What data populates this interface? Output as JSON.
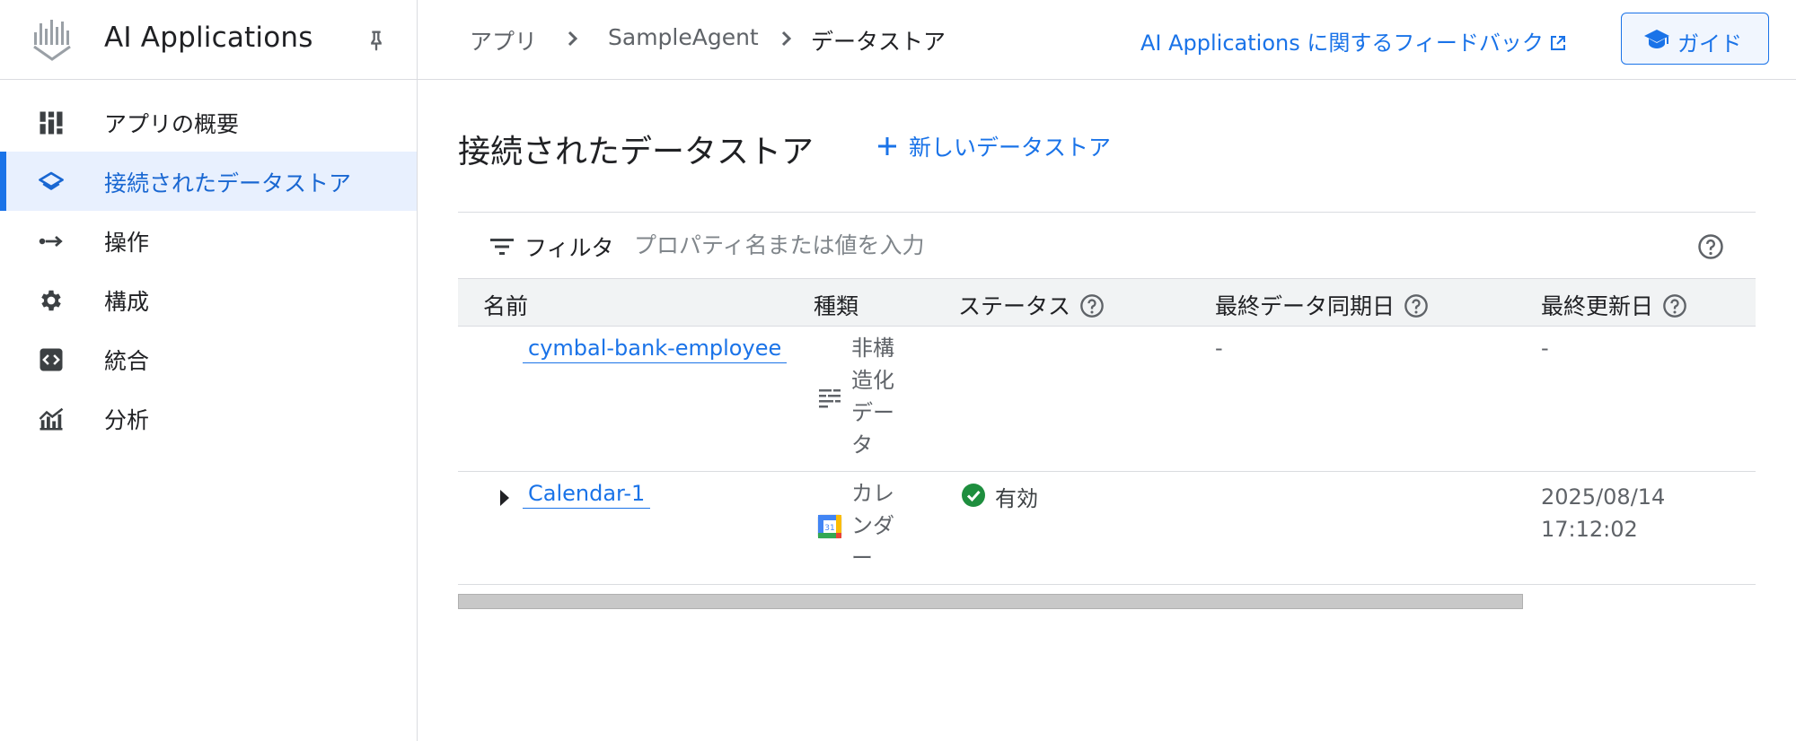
{
  "app": {
    "title": "AI Applications"
  },
  "sidebar": {
    "items": [
      {
        "label": "アプリの概要",
        "icon": "dashboard-icon",
        "active": false
      },
      {
        "label": "接続されたデータストア",
        "icon": "layers-icon",
        "active": true
      },
      {
        "label": "操作",
        "icon": "actions-icon",
        "active": false
      },
      {
        "label": "構成",
        "icon": "gear-icon",
        "active": false
      },
      {
        "label": "統合",
        "icon": "code-icon",
        "active": false
      },
      {
        "label": "分析",
        "icon": "analytics-icon",
        "active": false
      }
    ]
  },
  "breadcrumb": {
    "items": [
      "アプリ",
      "SampleAgent",
      "データストア"
    ]
  },
  "header": {
    "feedback_link": "AI Applications に関するフィードバック",
    "guide_label": "ガイド"
  },
  "main": {
    "title": "接続されたデータストア",
    "new_datastore": "新しいデータストア"
  },
  "filter": {
    "label": "フィルタ",
    "placeholder": "プロパティ名または値を入力"
  },
  "table": {
    "columns": [
      "名前",
      "種類",
      "ステータス",
      "最終データ同期日",
      "最終更新日"
    ],
    "rows": [
      {
        "name": "cymbal-bank-employee",
        "type": "非構造化データ",
        "type_icon": "unstructured-data-icon",
        "status": "",
        "last_sync": "-",
        "last_updated": "-"
      },
      {
        "name": "Calendar-1",
        "type": "カレンダー",
        "type_icon": "google-calendar-icon",
        "calendar_day": "31",
        "status": "有効",
        "status_icon": "check-circle-icon",
        "last_sync": "",
        "last_updated_date": "2025/08/14",
        "last_updated_time": "17:12:02"
      }
    ]
  },
  "colors": {
    "accent": "#1a73e8",
    "active_bg": "#e8f0fe",
    "success": "#1e8e3e",
    "header_bg": "#f1f3f4",
    "border": "#dadce0"
  }
}
